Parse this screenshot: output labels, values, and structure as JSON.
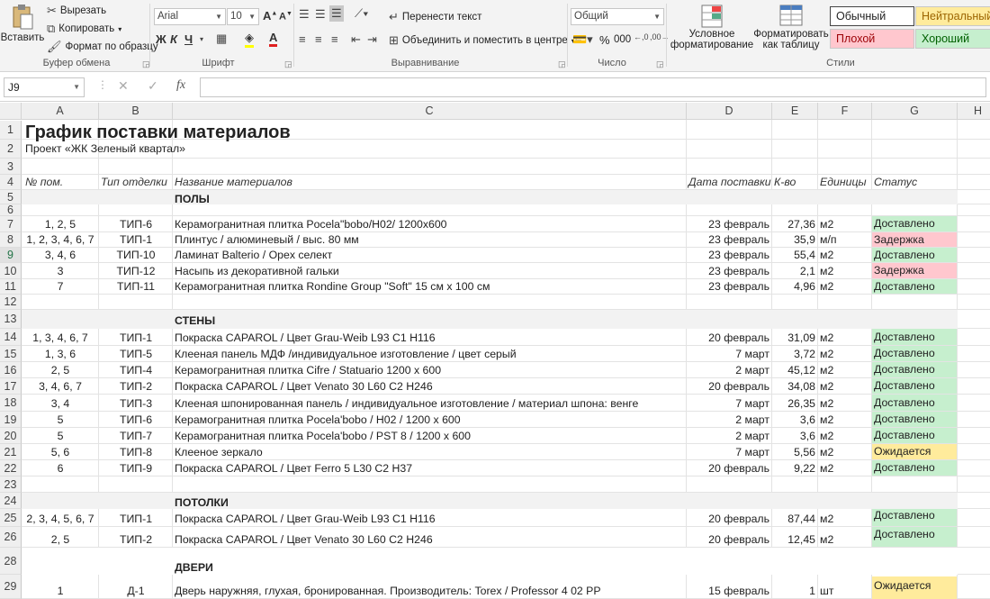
{
  "ribbon": {
    "clipboard": {
      "paste": "Вставить",
      "cut": "Вырезать",
      "copy": "Копировать",
      "format_painter": "Формат по образцу",
      "label": "Буфер обмена"
    },
    "font": {
      "name": "Arial",
      "size": "10",
      "bold": "Ж",
      "italic": "К",
      "underline": "Ч",
      "label": "Шрифт"
    },
    "alignment": {
      "wrap": "Перенести текст",
      "merge": "Объединить и поместить в центре",
      "label": "Выравнивание"
    },
    "number": {
      "format": "Общий",
      "percent": "%",
      "thousands": "000",
      "label": "Число"
    },
    "styles": {
      "conditional_1": "Условное",
      "conditional_2": "форматирование",
      "table_1": "Форматировать",
      "table_2": "как таблицу",
      "normal": "Обычный",
      "neutral": "Нейтральный",
      "bad": "Плохой",
      "good": "Хороший",
      "label": "Стили",
      "colors": {
        "neutral": "#ffeb9c",
        "bad": "#ffc7ce",
        "good": "#c6efce"
      }
    }
  },
  "formula_bar": {
    "name_box": "J9",
    "fx": "fx",
    "value": ""
  },
  "columns": [
    "A",
    "B",
    "C",
    "D",
    "E",
    "F",
    "G",
    "H"
  ],
  "rows": [
    "1",
    "2",
    "3",
    "4",
    "5",
    "6",
    "7",
    "8",
    "9",
    "10",
    "11",
    "12",
    "13",
    "14",
    "15",
    "16",
    "17",
    "18",
    "19",
    "20",
    "21",
    "22",
    "23",
    "24",
    "25",
    "26",
    "28",
    "29"
  ],
  "sheet": {
    "title": "График поставки материалов",
    "project": "Проект «ЖК Зеленый квартал»",
    "headers": {
      "a": "№ пом.",
      "b": "Тип отделки",
      "c": "Название материалов",
      "d": "Дата поставки",
      "e": "К-во",
      "f": "Единицы",
      "g": "Статус"
    },
    "sections": {
      "floors": "ПОЛЫ",
      "walls": "СТЕНЫ",
      "ceilings": "ПОТОЛКИ",
      "doors": "ДВЕРИ"
    },
    "items": [
      {
        "a": "1, 2, 5",
        "b": "ТИП-6",
        "c": "Керамогранитная плитка Pocela\"bobo/H02/ 1200х600",
        "d": "23 февраль",
        "e": "27,36",
        "f": "м2",
        "g": "Доставлено"
      },
      {
        "a": "1, 2, 3, 4, 6, 7",
        "b": "ТИП-1",
        "c": "Плинтус / алюминевый / выс. 80 мм",
        "d": "23 февраль",
        "e": "35,9",
        "f": "м/п",
        "g": "Задержка"
      },
      {
        "a": "3, 4, 6",
        "b": "ТИП-10",
        "c": "Ламинат Balterio / Opex селект",
        "d": "23 февраль",
        "e": "55,4",
        "f": "м2",
        "g": "Доставлено"
      },
      {
        "a": "3",
        "b": "ТИП-12",
        "c": "Насыпь из декоративной гальки",
        "d": "23 февраль",
        "e": "2,1",
        "f": "м2",
        "g": "Задержка"
      },
      {
        "a": "7",
        "b": "ТИП-11",
        "c": "Керамогранитная плитка Rondine Group \"Soft\" 15 см х 100 см",
        "d": "23 февраль",
        "e": "4,96",
        "f": "м2",
        "g": "Доставлено"
      },
      {
        "a": "1, 3, 4, 6, 7",
        "b": "ТИП-1",
        "c": "Покраска CAPAROL / Цвет Grau-Weib L93 C1 H116",
        "d": "20 февраль",
        "e": "31,09",
        "f": "м2",
        "g": "Доставлено"
      },
      {
        "a": "1, 3, 6",
        "b": "ТИП-5",
        "c": "Клееная панель МДФ /индивидуальное изготовление / цвет серый",
        "d": "7 март",
        "e": "3,72",
        "f": "м2",
        "g": "Доставлено"
      },
      {
        "a": "2, 5",
        "b": "ТИП-4",
        "c": "Керамогранитная плитка Cifre / Statuario 1200 x 600",
        "d": "2 март",
        "e": "45,12",
        "f": "м2",
        "g": "Доставлено"
      },
      {
        "a": "3, 4, 6, 7",
        "b": "ТИП-2",
        "c": "Покраска CAPAROL / Цвет Venato 30 L60 C2 H246",
        "d": "20 февраль",
        "e": "34,08",
        "f": "м2",
        "g": "Доставлено"
      },
      {
        "a": "3, 4",
        "b": "ТИП-3",
        "c": "Клееная шпонированная панель / индивидуальное изготовление / материал шпона: венге",
        "d": "7 март",
        "e": "26,35",
        "f": "м2",
        "g": "Доставлено"
      },
      {
        "a": "5",
        "b": "ТИП-6",
        "c": "Керамогранитная плитка Pocela'bobo / H02 / 1200 х 600",
        "d": "2 март",
        "e": "3,6",
        "f": "м2",
        "g": "Доставлено"
      },
      {
        "a": "5",
        "b": "ТИП-7",
        "c": "Керамогранитная плитка Pocela'bobo / PST 8 / 1200 х 600",
        "d": "2 март",
        "e": "3,6",
        "f": "м2",
        "g": "Доставлено"
      },
      {
        "a": "5, 6",
        "b": "ТИП-8",
        "c": "Клееное зеркало",
        "d": "7 март",
        "e": "5,56",
        "f": "м2",
        "g": "Ожидается"
      },
      {
        "a": "6",
        "b": "ТИП-9",
        "c": "Покраска CAPAROL / Цвет Ferro 5 L30 C2 H37",
        "d": "20 февраль",
        "e": "9,22",
        "f": "м2",
        "g": "Доставлено"
      },
      {
        "a": "2, 3, 4, 5, 6, 7",
        "b": "ТИП-1",
        "c": "Покраска CAPAROL / Цвет Grau-Weib L93 C1 H116",
        "d": "20 февраль",
        "e": "87,44",
        "f": "м2",
        "g": "Доставлено"
      },
      {
        "a": "2, 5",
        "b": "ТИП-2",
        "c": "Покраска CAPAROL / Цвет Venato 30 L60 C2 H246",
        "d": "20 февраль",
        "e": "12,45",
        "f": "м2",
        "g": "Доставлено"
      },
      {
        "a": "1",
        "b": "Д-1",
        "c": "Дверь наружняя, глухая, бронированная. Производитель: Torex / Professor 4 02 PP",
        "d": "15 февраль",
        "e": "1",
        "f": "шт",
        "g": "Ожидается"
      }
    ]
  }
}
